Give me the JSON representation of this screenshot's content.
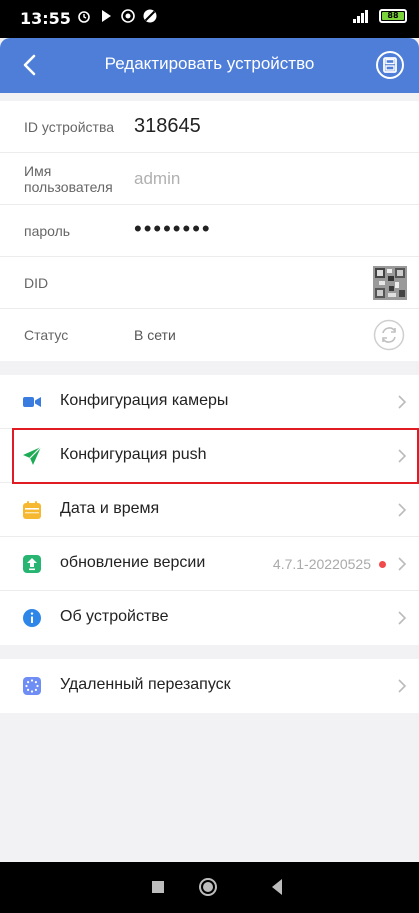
{
  "status_bar": {
    "time": "13:55",
    "battery": "88"
  },
  "header": {
    "title": "Редактировать устройство"
  },
  "device_info": {
    "id_label": "ID устройства",
    "id_value": "318645",
    "username_label_line1": "Имя",
    "username_label_line2": "пользователя",
    "username_value": "admin",
    "password_label": "пароль",
    "password_value": "••••••••",
    "did_label": "DID",
    "status_label": "Статус",
    "status_value": "В сети"
  },
  "menu": {
    "items": [
      {
        "label": "Конфигурация камеры",
        "icon": "camera-icon"
      },
      {
        "label": "Конфигурация push",
        "icon": "send-icon"
      },
      {
        "label": "Дата и время",
        "icon": "calendar-icon"
      },
      {
        "label": "обновление версии",
        "icon": "upload-icon",
        "version": "4.7.1-20220525"
      },
      {
        "label": "Об устройстве",
        "icon": "info-icon"
      }
    ],
    "reboot_label": "Удаленный перезапуск"
  },
  "colors": {
    "nav": "#4f7ed8",
    "highlight": "#e01b24",
    "camera": "#3a7be0",
    "push": "#1eab55",
    "calendar": "#f6b830",
    "upgrade": "#27b571",
    "info": "#2e86e8",
    "reboot": "#6f8ef5"
  }
}
